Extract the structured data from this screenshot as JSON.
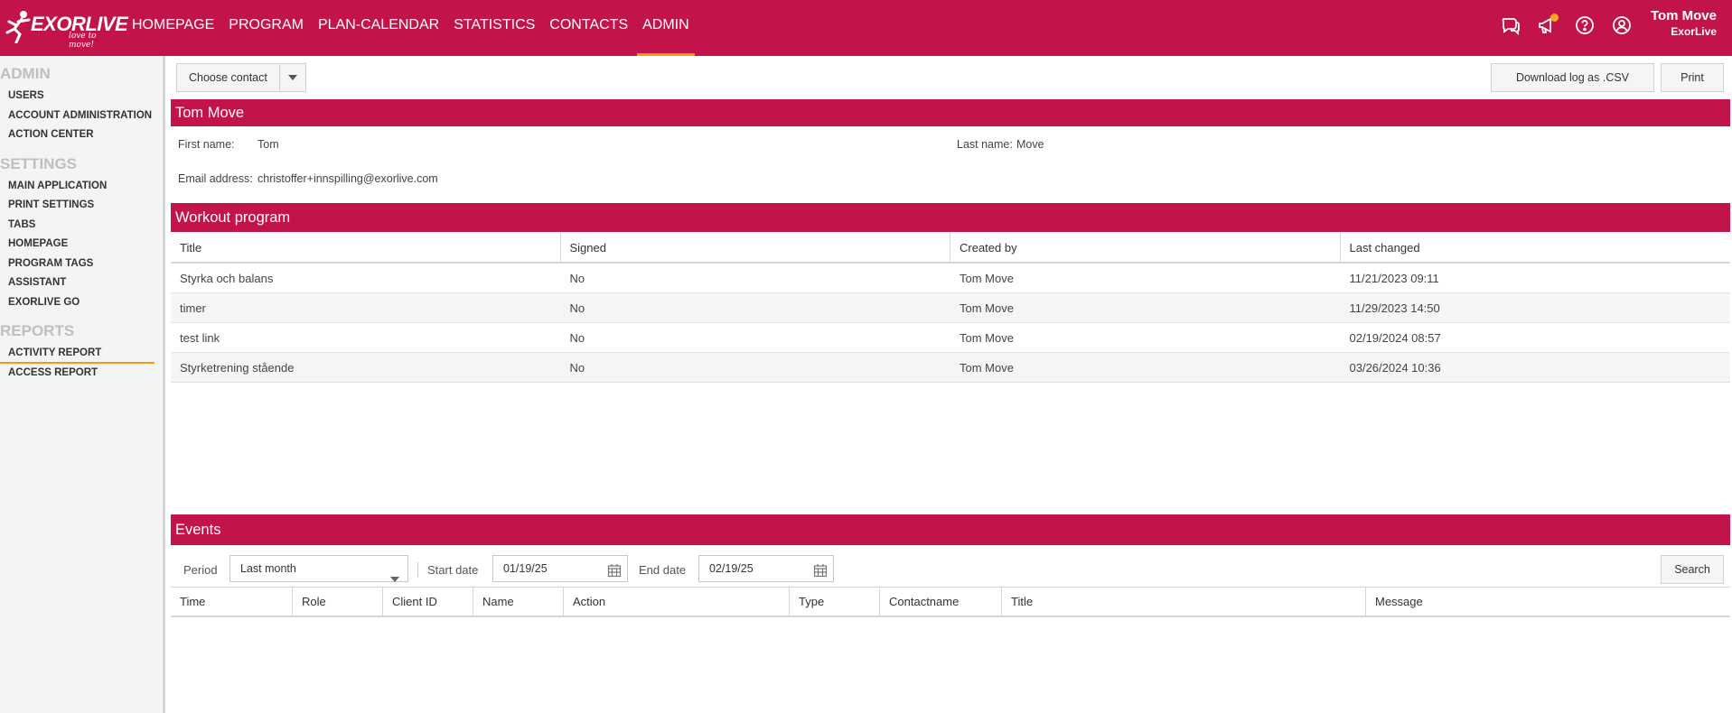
{
  "app": {
    "logo_text": "EXORLIVE",
    "logo_tagline": "love to move!"
  },
  "nav": {
    "items": [
      {
        "label": "HOMEPAGE"
      },
      {
        "label": "PROGRAM"
      },
      {
        "label": "PLAN-CALENDAR"
      },
      {
        "label": "STATISTICS"
      },
      {
        "label": "CONTACTS"
      },
      {
        "label": "ADMIN",
        "active": true
      }
    ]
  },
  "header_icons": [
    "chat-icon",
    "megaphone-icon",
    "help-icon",
    "user-circle-icon"
  ],
  "user": {
    "name": "Tom Move",
    "org": "ExorLive"
  },
  "sidebar": {
    "sections": [
      {
        "title": "ADMIN",
        "items": [
          "USERS",
          "ACCOUNT ADMINISTRATION",
          "ACTION CENTER"
        ]
      },
      {
        "title": "SETTINGS",
        "items": [
          "MAIN APPLICATION",
          "PRINT SETTINGS",
          "TABS",
          "HOMEPAGE",
          "PROGRAM TAGS",
          "ASSISTANT",
          "EXORLIVE GO"
        ]
      },
      {
        "title": "REPORTS",
        "items": [
          "ACTIVITY REPORT",
          "ACCESS REPORT"
        ]
      }
    ],
    "active_item": "ACTIVITY REPORT"
  },
  "toolbar": {
    "choose_contact": "Choose contact",
    "download_csv": "Download log as .CSV",
    "print": "Print"
  },
  "contact": {
    "header": "Tom Move",
    "first_name_label": "First name:",
    "first_name": "Tom",
    "last_name_label": "Last name:",
    "last_name": "Move",
    "email_label": "Email address:",
    "email": "christoffer+innspilling@exorlive.com"
  },
  "workout": {
    "header": "Workout program",
    "columns": [
      "Title",
      "Signed",
      "Created by",
      "Last changed"
    ],
    "rows": [
      [
        "Styrka och balans",
        "No",
        "Tom Move",
        "11/21/2023 09:11"
      ],
      [
        "timer",
        "No",
        "Tom Move",
        "11/29/2023 14:50"
      ],
      [
        "test link",
        "No",
        "Tom Move",
        "02/19/2024 08:57"
      ],
      [
        "Styrketrening stående",
        "No",
        "Tom Move",
        "03/26/2024 10:36"
      ]
    ]
  },
  "events": {
    "header": "Events",
    "period_label": "Period",
    "period_value": "Last month",
    "start_label": "Start date",
    "start_value": "01/19/25",
    "end_label": "End date",
    "end_value": "02/19/25",
    "search": "Search",
    "columns": [
      "Time",
      "Role",
      "Client ID",
      "Name",
      "Action",
      "Type",
      "Contactname",
      "Title",
      "Message"
    ]
  },
  "colors": {
    "brand": "#c2134b",
    "accent": "#f39c12",
    "notification": "#f5a623"
  }
}
